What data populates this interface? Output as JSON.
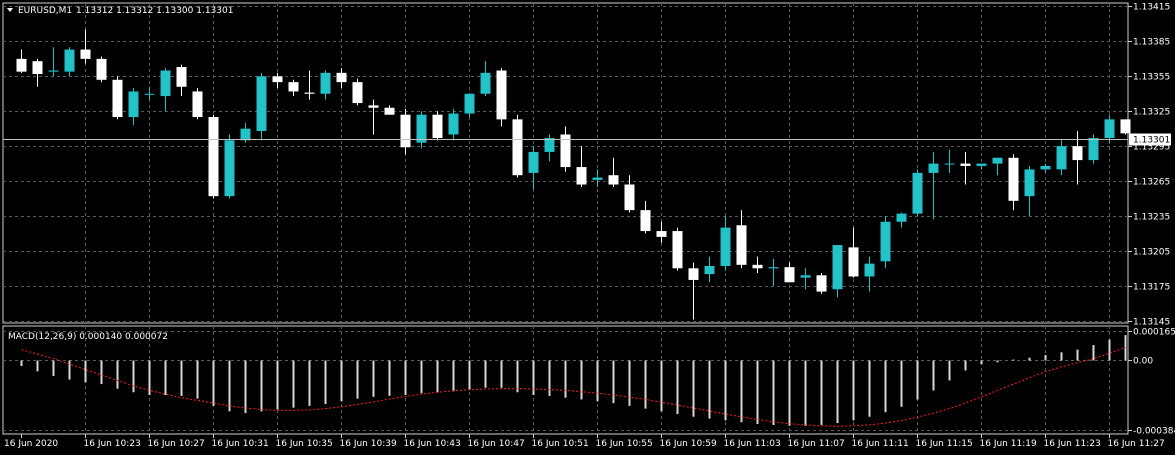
{
  "header": {
    "symbol_label": "EURUSD,M1",
    "ohlc": "1.13312 1.13312 1.13300 1.13301"
  },
  "macd_header": {
    "label": "MACD(12,26,9) 0.000140 0.000072"
  },
  "colors": {
    "background": "#000000",
    "foreground": "#ffffff",
    "grid": "#5a5a5a",
    "bull": "#22c2c8",
    "bear": "#ffffff",
    "signal": "#ff2020"
  },
  "chart_data": [
    {
      "type": "candlestick",
      "symbol": "EURUSD",
      "timeframe": "M1",
      "bid_label": "1.13301",
      "y_ticks": [
        "1.13415",
        "1.13385",
        "1.13355",
        "1.13325",
        "1.13295",
        "1.13265",
        "1.13235",
        "1.13205",
        "1.13175",
        "1.13145"
      ],
      "ylim": [
        1.13143,
        1.13418
      ],
      "grid": true,
      "x_ticks": [
        "16 Jun 2020",
        "16 Jun 10:23",
        "16 Jun 10:27",
        "16 Jun 10:31",
        "16 Jun 10:35",
        "16 Jun 10:39",
        "16 Jun 10:43",
        "16 Jun 10:47",
        "16 Jun 10:51",
        "16 Jun 10:55",
        "16 Jun 10:59",
        "16 Jun 11:03",
        "16 Jun 11:07",
        "16 Jun 11:11",
        "16 Jun 11:15",
        "16 Jun 11:19",
        "16 Jun 11:23",
        "16 Jun 11:27"
      ],
      "candles": [
        [
          1.1337,
          1.13378,
          1.13358,
          1.13359
        ],
        [
          1.13368,
          1.1337,
          1.13346,
          1.13357
        ],
        [
          1.13359,
          1.1338,
          1.13355,
          1.1336
        ],
        [
          1.13359,
          1.1338,
          1.13355,
          1.13378
        ],
        [
          1.13378,
          1.13395,
          1.13366,
          1.1337
        ],
        [
          1.1337,
          1.13372,
          1.1335,
          1.13352
        ],
        [
          1.13352,
          1.13355,
          1.13318,
          1.1332
        ],
        [
          1.1332,
          1.13345,
          1.13313,
          1.13342
        ],
        [
          1.1334,
          1.13346,
          1.13335,
          1.1334
        ],
        [
          1.13338,
          1.13362,
          1.13325,
          1.1336
        ],
        [
          1.13363,
          1.13365,
          1.13338,
          1.13346
        ],
        [
          1.13342,
          1.13345,
          1.13318,
          1.1332
        ],
        [
          1.1332,
          1.13322,
          1.1325,
          1.13252
        ],
        [
          1.13252,
          1.13305,
          1.1325,
          1.133
        ],
        [
          1.133,
          1.13315,
          1.13298,
          1.1331
        ],
        [
          1.13308,
          1.13358,
          1.133,
          1.13355
        ],
        [
          1.13355,
          1.13358,
          1.13345,
          1.1335
        ],
        [
          1.1335,
          1.13352,
          1.13338,
          1.13342
        ],
        [
          1.13341,
          1.1336,
          1.13335,
          1.1334
        ],
        [
          1.1334,
          1.1336,
          1.13335,
          1.13358
        ],
        [
          1.13358,
          1.13362,
          1.13345,
          1.1335
        ],
        [
          1.1335,
          1.13353,
          1.1333,
          1.13332
        ],
        [
          1.1333,
          1.13335,
          1.13305,
          1.13328
        ],
        [
          1.13328,
          1.1333,
          1.13322,
          1.13322
        ],
        [
          1.13322,
          1.13327,
          1.13288,
          1.13294
        ],
        [
          1.13298,
          1.13325,
          1.13293,
          1.13322
        ],
        [
          1.13322,
          1.13325,
          1.133,
          1.13302
        ],
        [
          1.13305,
          1.13327,
          1.133,
          1.13323
        ],
        [
          1.13323,
          1.1334,
          1.1332,
          1.1334
        ],
        [
          1.1334,
          1.13368,
          1.13338,
          1.13358
        ],
        [
          1.1336,
          1.13362,
          1.13312,
          1.13318
        ],
        [
          1.13318,
          1.13322,
          1.13268,
          1.1327
        ],
        [
          1.13272,
          1.13295,
          1.13258,
          1.1329
        ],
        [
          1.1329,
          1.13305,
          1.13282,
          1.13302
        ],
        [
          1.13305,
          1.13312,
          1.13273,
          1.13277
        ],
        [
          1.13277,
          1.13295,
          1.1326,
          1.13262
        ],
        [
          1.13266,
          1.13275,
          1.1326,
          1.13268
        ],
        [
          1.1327,
          1.13285,
          1.1326,
          1.13262
        ],
        [
          1.13262,
          1.1327,
          1.13238,
          1.1324
        ],
        [
          1.1324,
          1.13248,
          1.1322,
          1.13222
        ],
        [
          1.13222,
          1.1323,
          1.13212,
          1.13217
        ],
        [
          1.13222,
          1.13225,
          1.13188,
          1.1319
        ],
        [
          1.1319,
          1.13195,
          1.13146,
          1.1318
        ],
        [
          1.13185,
          1.132,
          1.13178,
          1.13192
        ],
        [
          1.13192,
          1.13235,
          1.13188,
          1.13225
        ],
        [
          1.13227,
          1.1324,
          1.1319,
          1.13193
        ],
        [
          1.13193,
          1.132,
          1.13186,
          1.1319
        ],
        [
          1.1319,
          1.13198,
          1.13175,
          1.13191
        ],
        [
          1.13191,
          1.13195,
          1.13178,
          1.13178
        ],
        [
          1.13182,
          1.1319,
          1.13172,
          1.13184
        ],
        [
          1.13184,
          1.13186,
          1.13168,
          1.1317
        ],
        [
          1.13172,
          1.1321,
          1.13165,
          1.1321
        ],
        [
          1.13208,
          1.13225,
          1.13182,
          1.13183
        ],
        [
          1.13183,
          1.132,
          1.1317,
          1.13194
        ],
        [
          1.13196,
          1.13235,
          1.1319,
          1.1323
        ],
        [
          1.1323,
          1.13238,
          1.13225,
          1.13237
        ],
        [
          1.13237,
          1.13275,
          1.13235,
          1.13272
        ],
        [
          1.13272,
          1.1329,
          1.13232,
          1.1328
        ],
        [
          1.1328,
          1.13292,
          1.13272,
          1.1328
        ],
        [
          1.1328,
          1.1329,
          1.13262,
          1.13278
        ],
        [
          1.13278,
          1.1328,
          1.13275,
          1.1328
        ],
        [
          1.1328,
          1.13285,
          1.1327,
          1.13285
        ],
        [
          1.13285,
          1.13288,
          1.1324,
          1.13248
        ],
        [
          1.13252,
          1.13278,
          1.13235,
          1.13275
        ],
        [
          1.13275,
          1.1328,
          1.13272,
          1.13278
        ],
        [
          1.13275,
          1.133,
          1.1327,
          1.13295
        ],
        [
          1.13295,
          1.13308,
          1.13262,
          1.13283
        ],
        [
          1.13283,
          1.13305,
          1.1328,
          1.13302
        ],
        [
          1.13302,
          1.13322,
          1.13298,
          1.13318
        ],
        [
          1.13318,
          1.13318,
          1.13305,
          1.13306
        ]
      ]
    },
    {
      "type": "macd",
      "name": "MACD(12,26,9)",
      "y_ticks": [
        "0.000165",
        "0.00",
        "-0.000384"
      ],
      "ylim": [
        -0.000405,
        0.00019
      ],
      "grid": true,
      "histogram": [
        -3e-05,
        -6e-05,
        -8.5e-05,
        -0.000105,
        -0.00012,
        -0.00013,
        -0.000155,
        -0.000175,
        -0.00019,
        -0.00019,
        -0.000195,
        -0.00021,
        -0.00025,
        -0.00028,
        -0.00029,
        -0.00028,
        -0.00027,
        -0.00026,
        -0.00025,
        -0.00024,
        -0.000225,
        -0.00021,
        -0.0002,
        -0.000195,
        -0.00019,
        -0.00018,
        -0.000175,
        -0.00017,
        -0.00016,
        -0.00015,
        -0.00015,
        -0.000175,
        -0.00019,
        -0.000195,
        -0.000205,
        -0.000215,
        -0.000225,
        -0.000235,
        -0.00025,
        -0.000265,
        -0.00028,
        -0.000295,
        -0.00031,
        -0.00032,
        -0.00033,
        -0.00034,
        -0.00035,
        -0.000355,
        -0.00036,
        -0.00036,
        -0.000355,
        -0.000345,
        -0.00033,
        -0.00031,
        -0.000285,
        -0.000255,
        -0.000215,
        -0.000165,
        -0.00011,
        -5.5e-05,
        -2e-05,
        -1e-05,
        5e-06,
        1.5e-05,
        3e-05,
        4.5e-05,
        6e-05,
        8.5e-05,
        0.000115,
        0.00014
      ],
      "signal": [
        6e-05,
        3.5e-05,
        1e-05,
        -2e-05,
        -5e-05,
        -8e-05,
        -0.00011,
        -0.00014,
        -0.000165,
        -0.000185,
        -0.000205,
        -0.00022,
        -0.000235,
        -0.00025,
        -0.000262,
        -0.00027,
        -0.000275,
        -0.000275,
        -0.000272,
        -0.000265,
        -0.000255,
        -0.000242,
        -0.000228,
        -0.000212,
        -0.000198,
        -0.000185,
        -0.000175,
        -0.000167,
        -0.000161,
        -0.000157,
        -0.000155,
        -0.000155,
        -0.000157,
        -0.00016,
        -0.000165,
        -0.000172,
        -0.00018,
        -0.00019,
        -0.000202,
        -0.000215,
        -0.00023,
        -0.000245,
        -0.000262,
        -0.000278,
        -0.000295,
        -0.00031,
        -0.000325,
        -0.000338,
        -0.000348,
        -0.000355,
        -0.00036,
        -0.000362,
        -0.00036,
        -0.000355,
        -0.000345,
        -0.00033,
        -0.000312,
        -0.00029,
        -0.000265,
        -0.000235,
        -0.0002,
        -0.000165,
        -0.00013,
        -9.5e-05,
        -6.2e-05,
        -3.5e-05,
        -1.2e-05,
        1e-05,
        4e-05,
        7.2e-05
      ]
    }
  ]
}
